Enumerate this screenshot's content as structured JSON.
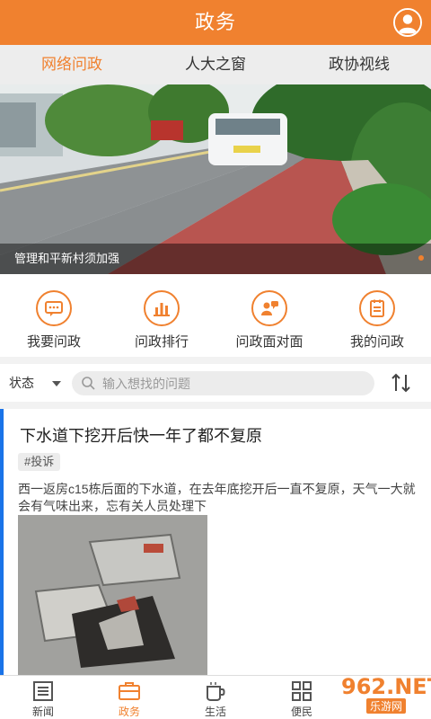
{
  "header": {
    "title": "政务",
    "avatar_icon": "user-avatar-icon"
  },
  "tabs": [
    {
      "label": "网络问政",
      "active": true
    },
    {
      "label": "人大之窗",
      "active": false
    },
    {
      "label": "政协视线",
      "active": false
    }
  ],
  "banner": {
    "caption": "管理和平新村须加强"
  },
  "quick_actions": [
    {
      "label": "我要问政",
      "icon": "message-icon"
    },
    {
      "label": "问政排行",
      "icon": "bar-chart-icon"
    },
    {
      "label": "问政面对面",
      "icon": "people-chat-icon"
    },
    {
      "label": "我的问政",
      "icon": "notepad-icon"
    }
  ],
  "filter": {
    "status_label": "状态",
    "search_placeholder": "输入想找的问题"
  },
  "post": {
    "title": "下水道下挖开后快一年了都不复原",
    "tag": "#投诉",
    "description": "西一返房c15栋后面的下水道，在去年底挖开后一直不复原，天气一大就会有气味出来，忘有关人员处理下"
  },
  "bottom_nav": [
    {
      "label": "新闻",
      "icon": "newspaper-icon",
      "active": false
    },
    {
      "label": "政务",
      "icon": "briefcase-icon",
      "active": true
    },
    {
      "label": "生活",
      "icon": "cup-icon",
      "active": false
    },
    {
      "label": "便民",
      "icon": "grid-icon",
      "active": false
    }
  ],
  "watermark": {
    "text": "962.NET",
    "sub": "乐游网"
  },
  "colors": {
    "accent": "#f0812f",
    "card_accent": "#1a73e8"
  }
}
